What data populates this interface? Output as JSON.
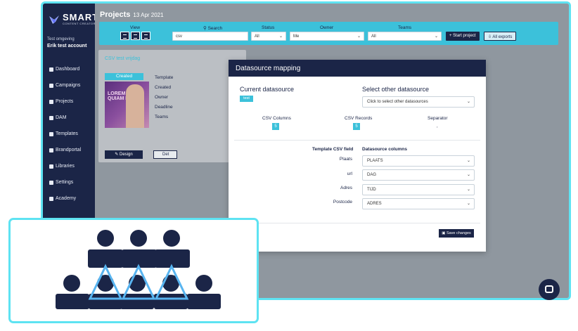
{
  "app": {
    "logo_main": "SMART",
    "logo_sub": "CONTENT CREATOR"
  },
  "sidebar": {
    "org": "Test omgeving",
    "account": "Erik test account",
    "items": [
      {
        "label": "Dashboard",
        "icon": "home-icon"
      },
      {
        "label": "Campaigns",
        "icon": "megaphone-icon"
      },
      {
        "label": "Projects",
        "icon": "projects-icon"
      },
      {
        "label": "DAM",
        "icon": "images-icon"
      },
      {
        "label": "Templates",
        "icon": "template-icon"
      },
      {
        "label": "Brandportal",
        "icon": "book-icon"
      },
      {
        "label": "Libraries",
        "icon": "library-icon"
      },
      {
        "label": "Settings",
        "icon": "gear-icon"
      },
      {
        "label": "Academy",
        "icon": "video-icon"
      }
    ]
  },
  "header": {
    "title": "Projects",
    "date": "13 Apr 2021"
  },
  "filters": {
    "view_label": "View",
    "search_label": "Search",
    "search_value": "csv",
    "status_label": "Status",
    "status_value": "All",
    "owner_label": "Owner",
    "owner_value": "Me",
    "teams_label": "Teams",
    "teams_value": "All",
    "start_project": "Start project",
    "all_exports": "All exports"
  },
  "card": {
    "title": "CSV test vrijdag",
    "status": "Created",
    "thumb_text": "LOREM IPSUM QUIAM LOR",
    "meta": [
      "Template",
      "Created",
      "Owner",
      "Deadline",
      "Teams"
    ],
    "design_label": "Design",
    "details_label": "Det"
  },
  "modal": {
    "title": "Datasource mapping",
    "current_title": "Current datasource",
    "current_badge": "test",
    "other_title": "Select other datasource",
    "other_placeholder": "Click to select other datasources",
    "csv_columns_label": "CSV Columns",
    "csv_columns_value": "5",
    "csv_records_label": "CSV Records",
    "csv_records_value": "5",
    "separator_label": "Separator",
    "separator_value": ",",
    "template_field_header": "Template CSV field",
    "datasource_col_header": "Datasource columns",
    "mappings": [
      {
        "field": "Plaats",
        "column": "PLAATS"
      },
      {
        "field": "url",
        "column": "DAG"
      },
      {
        "field": "Adres",
        "column": "TIJD"
      },
      {
        "field": "Postcode",
        "column": "ADRES"
      }
    ],
    "save_label": "Save changes"
  },
  "colors": {
    "navy": "#1b2547",
    "accent": "#3cc1da",
    "frame": "#5ee3f2"
  }
}
